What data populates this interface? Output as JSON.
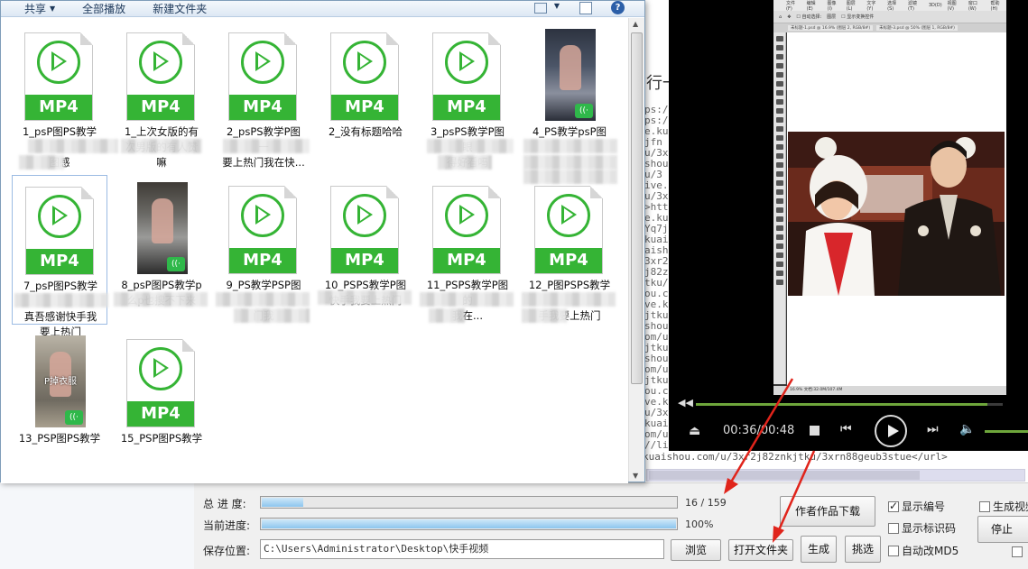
{
  "explorer": {
    "toolbar": {
      "share_label": "共享",
      "play_all_label": "全部播放",
      "new_folder_label": "新建文件夹",
      "help_label": "?"
    },
    "files": [
      {
        "type": "mp4",
        "badge": "MP4",
        "lines": [
          "1_psP图PS教学",
          "",
          "图感"
        ]
      },
      {
        "type": "mp4",
        "badge": "MP4",
        "lines": [
          "1_上次女版的有",
          "次男版的有人赞",
          "嘛"
        ]
      },
      {
        "type": "mp4",
        "badge": "MP4",
        "lines": [
          "2_psPS教学P图",
          "一",
          "要上热门我在快..."
        ]
      },
      {
        "type": "mp4",
        "badge": "MP4",
        "lines": [
          "2_没有标题哈哈"
        ]
      },
      {
        "type": "mp4",
        "badge": "MP4",
        "lines": [
          "3_psPS教学P图",
          "眼",
          "得好看吗"
        ]
      },
      {
        "type": "photo",
        "lines": [
          "4_PS教学psP图",
          "",
          ""
        ]
      },
      {
        "type": "mp4",
        "badge": "MP4",
        "lines": [
          "7_psP图PS教学",
          "",
          "真吾感谢快手我",
          "要上热门"
        ]
      },
      {
        "type": "photo",
        "lines": [
          "8_psP图PS教学p",
          "么p也搜不下来"
        ]
      },
      {
        "type": "mp4",
        "badge": "MP4",
        "lines": [
          "9_PS教学PSP图",
          "",
          "门我"
        ]
      },
      {
        "type": "mp4",
        "badge": "MP4",
        "lines": [
          "10_PSPS教学P图",
          "快手我要上热门"
        ]
      },
      {
        "type": "mp4",
        "badge": "MP4",
        "lines": [
          "11_PSPS教学P图",
          "的",
          "我在..."
        ]
      },
      {
        "type": "mp4",
        "badge": "MP4",
        "lines": [
          "12_P图PSPS教学",
          "",
          "手我要上热门"
        ]
      },
      {
        "type": "photo",
        "overlay": "P掉衣服",
        "lines": [
          "13_PSP图PS教学"
        ]
      },
      {
        "type": "mp4",
        "badge": "MP4",
        "lines": [
          "15_PSP图PS教学"
        ]
      }
    ]
  },
  "log": {
    "prefix": "行一",
    "lines": [
      "ps:/",
      "ps:/",
      "e.kua",
      "jfn",
      "u/3x",
      "shou",
      "u/3",
      "ive.k",
      "u/3x",
      ">htt",
      "e.kua",
      "Yq7j",
      "kuai",
      "aish",
      "3xr2",
      "j82z",
      "tku/",
      "ou.co",
      "ve.ku",
      "jtku",
      "shou",
      "om/u",
      "jtku/",
      "shou",
      "om/u",
      "jtku/",
      "ou.co",
      "ve.ku",
      "u/3xr",
      "kuais",
      "om/u/3",
      "//li"
    ],
    "last_line": "kuaishou.com/u/3xr2j82znkjtku/3xrn88geub3stue</url>"
  },
  "player": {
    "time_text": "00:36/00:48",
    "progress_fraction": 0.95,
    "ps_menu": [
      "文件(F)",
      "编辑(E)",
      "图像(I)",
      "图层(L)",
      "文字(Y)",
      "选择(S)",
      "滤镜(T)",
      "3D(D)",
      "视图(V)",
      "窗口(W)",
      "帮助(H)"
    ],
    "ps_tabs": [
      "未标题-1.psd @ 16.9% (图层 2, RGB/8#)",
      "未标题-3.psd @ 50% (图层 1, RGB/8#)"
    ],
    "ps_status": "16.9%    文档:32.0M/107.4M"
  },
  "downloader": {
    "total_progress_label": "总 进 度:",
    "total_progress_text": "16 / 159",
    "total_progress_fraction": 0.1,
    "current_progress_label": "当前进度:",
    "current_progress_text": "100%",
    "current_progress_fraction": 1.0,
    "save_location_label": "保存位置:",
    "save_path": "C:\\Users\\Administrator\\Desktop\\快手视频",
    "browse_label": "浏览",
    "open_folder_label": "打开文件夹",
    "author_download_label": "作者作品下载",
    "generate_label": "生成",
    "pick_label": "挑选",
    "stop_label": "停止",
    "checkboxes": [
      {
        "label": "显示编号",
        "checked": true
      },
      {
        "label": "显示标识码",
        "checked": false
      },
      {
        "label": "自动改MD5",
        "checked": false
      },
      {
        "label": "生成视频",
        "checked": false
      }
    ]
  },
  "colors": {
    "mp4_green": "#35b435",
    "annotation_red": "#e0241b",
    "player_progress": "#6ea63b"
  }
}
